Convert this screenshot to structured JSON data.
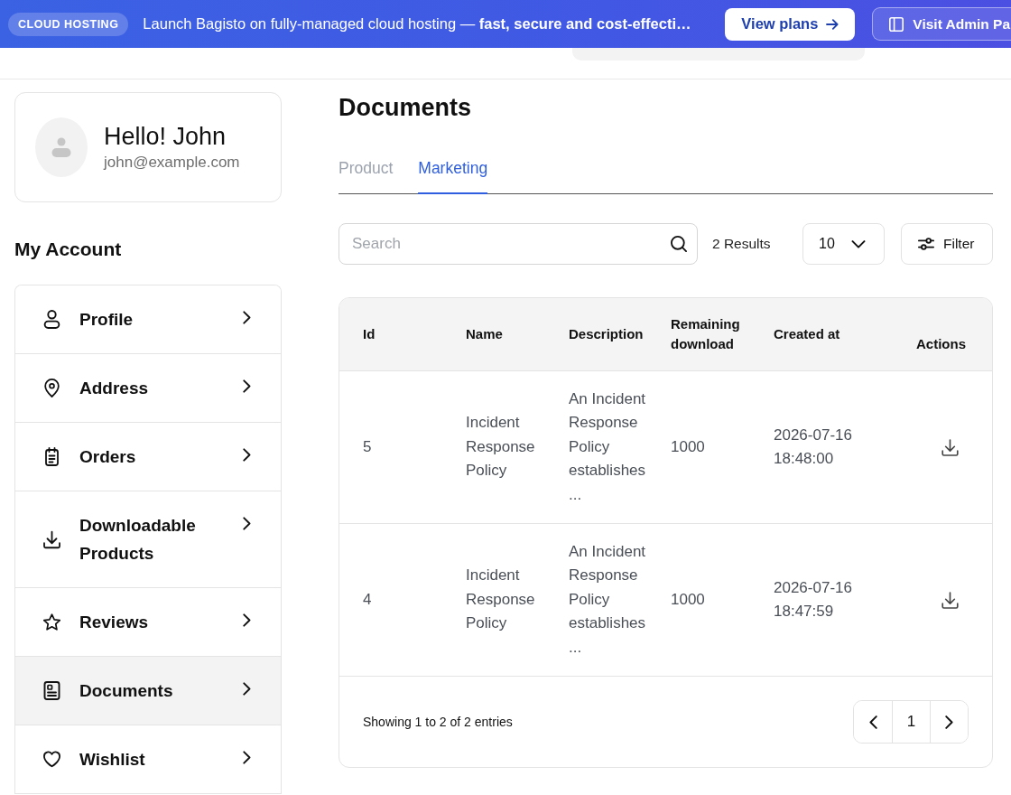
{
  "banner": {
    "tag": "CLOUD HOSTING",
    "message": "Launch Bagisto on fully-managed cloud hosting — **fast, secure and cost-effecti…**",
    "buttons": [
      {
        "label": "View plans",
        "kind": "primary"
      },
      {
        "label": "Visit Admin Pa",
        "kind": "outline"
      }
    ]
  },
  "profile": {
    "greeting": "Hello! John",
    "email": "john@example.com"
  },
  "sidebar": {
    "title": "My Account",
    "items": [
      {
        "label": "Profile",
        "selected": false
      },
      {
        "label": "Address",
        "selected": false
      },
      {
        "label": "Orders",
        "selected": false
      },
      {
        "label": "Downloadable Products",
        "selected": false
      },
      {
        "label": "Reviews",
        "selected": false
      },
      {
        "label": "Documents",
        "selected": true
      },
      {
        "label": "Wishlist",
        "selected": false
      }
    ]
  },
  "page": {
    "title": "Documents",
    "tabs": [
      {
        "label": "Product",
        "selected": false
      },
      {
        "label": "Marketing",
        "selected": true
      }
    ]
  },
  "toolbar": {
    "search": {
      "placeholder": "Search"
    },
    "results": "2 Results",
    "per_page": "10",
    "filter": "Filter"
  },
  "table": {
    "columns": [
      "Id",
      "Name",
      "Description",
      "Remaining download",
      "Created at",
      "Actions"
    ],
    "rows": [
      {
        "id": "5",
        "name": "Incident Response Policy",
        "description": "An Incident Response Policy establishes ...",
        "remaining_download": "1000",
        "created_at": "2026-07-16 18:48:00"
      },
      {
        "id": "4",
        "name": "Incident Response Policy",
        "description": "An Incident Response Policy establishes ...",
        "remaining_download": "1000",
        "created_at": "2026-07-16 18:47:59"
      }
    ]
  },
  "pagination": {
    "summary": "Showing 1 to 2 of 2 entries",
    "page": "1"
  }
}
